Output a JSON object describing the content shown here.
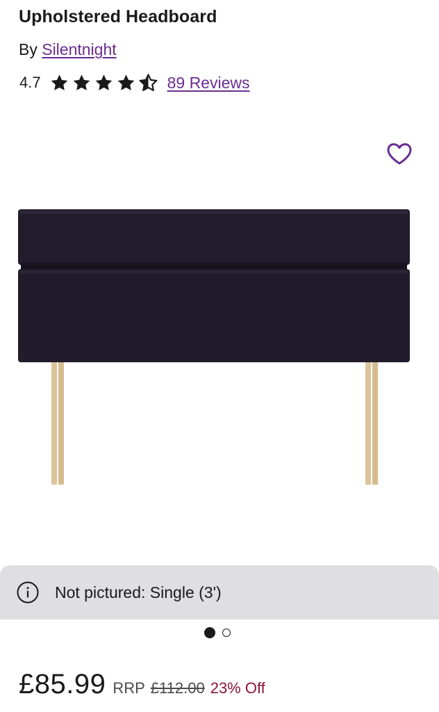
{
  "product": {
    "title": "Upholstered Headboard",
    "by_prefix": "By",
    "brand": "Silentnight"
  },
  "rating": {
    "value": "4.7",
    "stars": 4.7,
    "max_stars": 5,
    "reviews_label": "89 Reviews"
  },
  "wishlist": {
    "icon": "heart-icon"
  },
  "image_note": {
    "icon": "info-icon",
    "text": "Not pictured: Single (3')"
  },
  "gallery": {
    "current_index": 1,
    "total": 2
  },
  "pricing": {
    "price": "£85.99",
    "rrp_label": "RRP",
    "rrp_value": "£112.00",
    "discount": "23% Off"
  },
  "colors": {
    "brand_purple": "#6b2c91",
    "discount_red": "#8a1538",
    "headboard_fabric": "#221b2b",
    "legs_wood": "#dcc39a",
    "info_bar_bg": "#dedee3"
  }
}
